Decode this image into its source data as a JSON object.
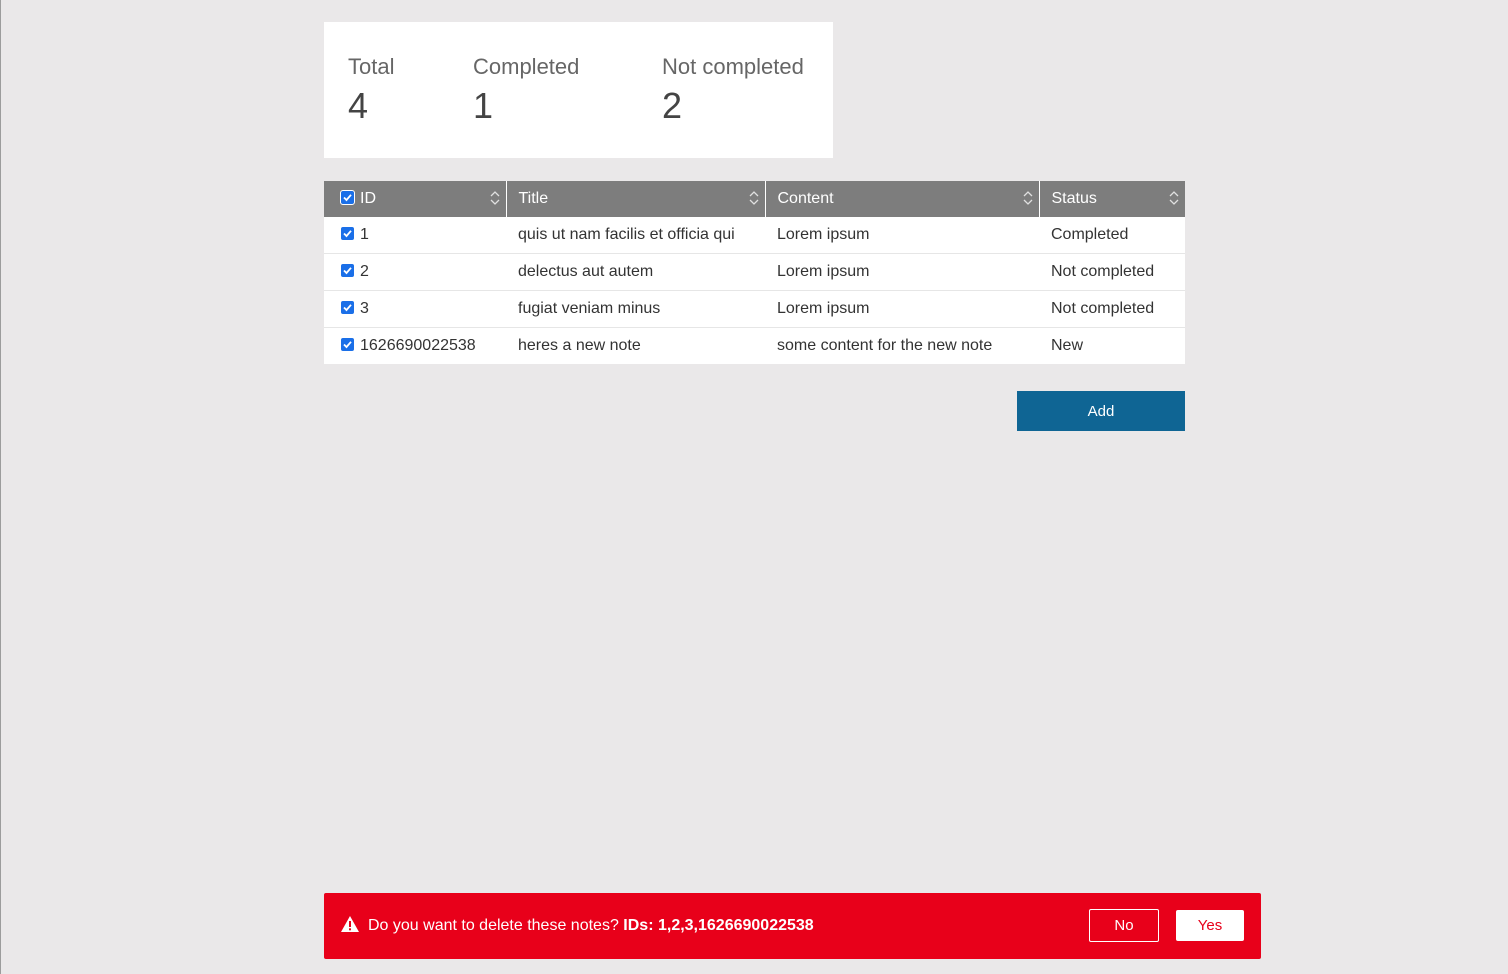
{
  "summary": {
    "total_label": "Total",
    "total_value": "4",
    "completed_label": "Completed",
    "completed_value": "1",
    "not_completed_label": "Not completed",
    "not_completed_value": "2"
  },
  "table": {
    "headers": {
      "id": "ID",
      "title": "Title",
      "content": "Content",
      "status": "Status"
    },
    "header_select_all_checked": true,
    "rows": [
      {
        "checked": true,
        "id": "1",
        "title": "quis ut nam facilis et officia qui",
        "content": "Lorem ipsum",
        "status": "Completed"
      },
      {
        "checked": true,
        "id": "2",
        "title": "delectus aut autem",
        "content": "Lorem ipsum",
        "status": "Not completed"
      },
      {
        "checked": true,
        "id": "3",
        "title": "fugiat veniam minus",
        "content": "Lorem ipsum",
        "status": "Not completed"
      },
      {
        "checked": true,
        "id": "1626690022538",
        "title": "heres a new note",
        "content": "some content for the new note",
        "status": "New"
      }
    ]
  },
  "actions": {
    "add_label": "Add"
  },
  "confirm": {
    "message": "Do you want to delete these notes?",
    "ids_text": "IDs: 1,2,3,1626690022538",
    "no_label": "No",
    "yes_label": "Yes"
  },
  "colors": {
    "background": "#eae8e9",
    "header_bg": "#7d7d7d",
    "add_button": "#0f6594",
    "danger": "#e8001a",
    "checkbox": "#1a6fe8"
  }
}
